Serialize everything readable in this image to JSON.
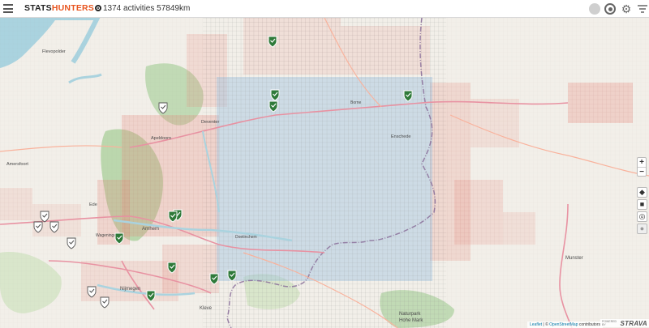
{
  "header": {
    "brand_stats": "STATS",
    "brand_hunters": "HUNTERS",
    "summary": "1374 activities 57849km"
  },
  "icons": {
    "menu": "hamburger-menu-icon",
    "status": "status-circle-icon",
    "record": "record-icon",
    "settings": "gear-icon",
    "filter": "filter-funnel-icon"
  },
  "controls": {
    "zoom_in": "+",
    "zoom_out": "−",
    "locate": "◆",
    "save": "■",
    "recenter": "◎",
    "streetview": "●"
  },
  "attribution": {
    "leaflet": "Leaflet",
    "sep": " | © ",
    "osm": "OpenStreetMap",
    "contributors": " contributors",
    "powered_by": "POWERED BY",
    "strava": "STRAVA"
  },
  "map_labels": {
    "flevopolder": "Flevopolder",
    "amersfoort": "Amersfoort",
    "ede": "Ede",
    "arnhem": "Arnhem",
    "apeldoorn": "Apeldoorn",
    "deventer": "Deventer",
    "wageningen": "Wageningen",
    "nijmegen": "Nijmegen",
    "kleve": "Kleve",
    "enschede": "Enschede",
    "munster": "Munster",
    "doetinchem": "Doetinchem",
    "borne": "Borne",
    "naturpark": "Naturpark",
    "hohe_mark": "Hohe Mark"
  },
  "colors": {
    "explored_fill": "#9fc4e0",
    "explored_stroke": "#6b8aa6",
    "cluster_fill": "#d9746a",
    "marker_green": "#3f8f3f",
    "marker_white": "#ffffff",
    "accent": "#e8541e"
  }
}
